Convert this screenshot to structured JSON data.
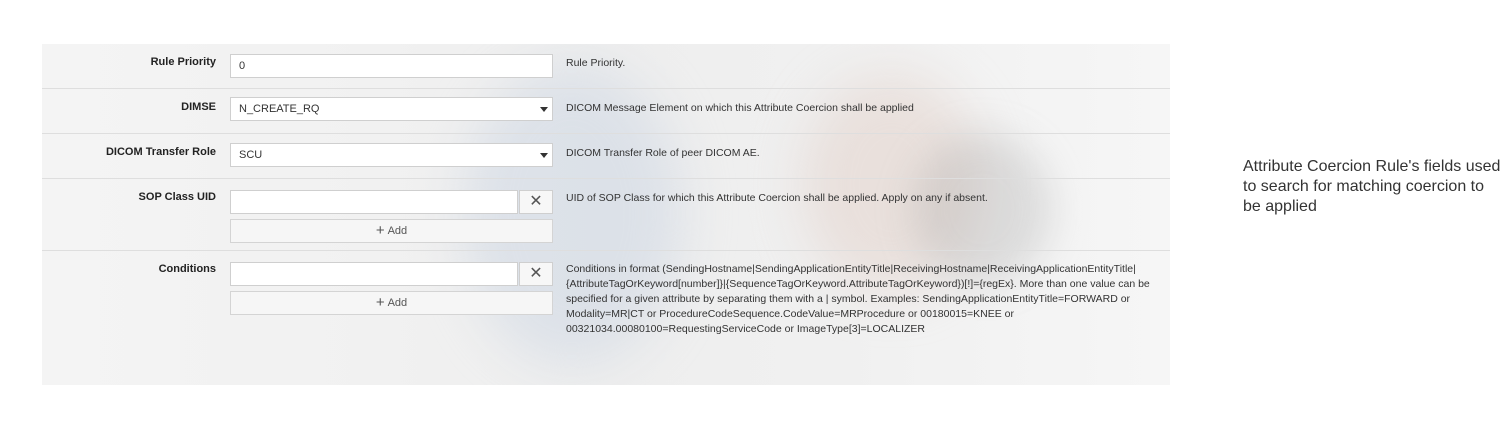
{
  "form": {
    "rows": [
      {
        "label": "Rule Priority",
        "value": "0",
        "description": "Rule Priority."
      },
      {
        "label": "DIMSE",
        "value": "N_CREATE_RQ",
        "description": "DICOM Message Element on which this Attribute Coercion shall be applied"
      },
      {
        "label": "DICOM Transfer Role",
        "value": "SCU",
        "description": "DICOM Transfer Role of peer DICOM AE."
      },
      {
        "label": "SOP Class UID",
        "value": "",
        "add_label": "Add",
        "description": "UID of SOP Class for which this Attribute Coercion shall be applied. Apply on any if absent."
      },
      {
        "label": "Conditions",
        "value": "",
        "add_label": "Add",
        "description": "Conditions in format (SendingHostname|SendingApplicationEntityTitle|ReceivingHostname|ReceivingApplicationEntityTitle|{AttributeTagOrKeyword[number]}|{SequenceTagOrKeyword.AttributeTagOrKeyword})[!]={regEx}. More than one value can be specified for a given attribute by separating them with a | symbol. Examples: SendingApplicationEntityTitle=FORWARD or Modality=MR|CT or ProcedureCodeSequence.CodeValue=MRProcedure or 00180015=KNEE or 00321034.00080100=RequestingServiceCode or ImageType[3]=LOCALIZER"
      }
    ]
  },
  "icons": {
    "remove": "close-icon",
    "add": "plus-icon",
    "dropdown": "caret-down-icon"
  },
  "side_note": "Attribute Coercion Rule's fields used to search for matching coercion to be applied"
}
